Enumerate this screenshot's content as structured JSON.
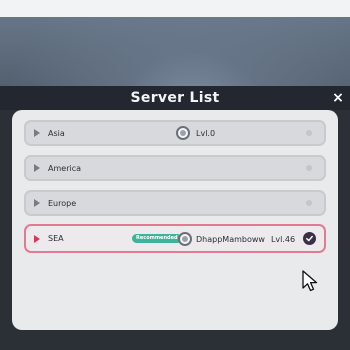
{
  "panel": {
    "title": "Server List",
    "close_label": "×"
  },
  "servers": [
    {
      "name": "Asia",
      "level": "Lvl.0"
    },
    {
      "name": "America"
    },
    {
      "name": "Europe"
    },
    {
      "name": "SEA",
      "badge": "Recommended",
      "player": "DhappMamboww",
      "level": "Lvl.46",
      "selected": true
    }
  ],
  "colors": {
    "accent": "#e37a94",
    "badge": "#3db39a",
    "row_bg": "#d8d9dc"
  },
  "icons": [
    "play-arrow-icon",
    "avatar-icon",
    "check-icon",
    "cursor-icon",
    "close-icon"
  ]
}
